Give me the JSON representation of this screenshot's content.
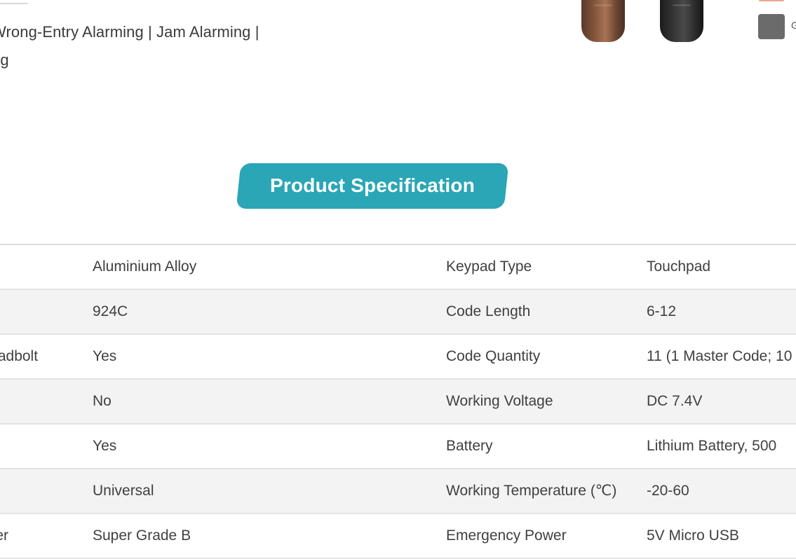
{
  "features": {
    "line1": "Wrong-Entry Alarming | Jam Alarming |",
    "line2": "ng"
  },
  "products": [
    {
      "name": "bronze-lock",
      "color": "#8a5a40"
    },
    {
      "name": "black-lock",
      "color": "#383838"
    }
  ],
  "swatch": {
    "color": "#6b6b6b",
    "label": "G"
  },
  "section": {
    "title": "Product Specification",
    "accent": "#2aa6b6"
  },
  "specs": {
    "rows": [
      {
        "label1": "",
        "value1": "Aluminium Alloy",
        "label2": "Keypad Type",
        "value2": "Touchpad"
      },
      {
        "label1": "",
        "value1": "924C",
        "label2": "Code Length",
        "value2": "6-12"
      },
      {
        "label1": "Deadbolt",
        "value1": "Yes",
        "label2": "Code Quantity",
        "value2": "11 (1 Master Code; 10"
      },
      {
        "label1": "",
        "value1": "No",
        "label2": "Working Voltage",
        "value2": "DC 7.4V"
      },
      {
        "label1": "",
        "value1": "Yes",
        "label2": "Battery",
        "value2": "Lithium Battery, 500"
      },
      {
        "label1": "",
        "value1": "Universal",
        "label2": "Working Temperature (℃)",
        "value2": "-20-60"
      },
      {
        "label1": "nder",
        "value1": "Super Grade B",
        "label2": "Emergency Power",
        "value2": "5V Micro USB"
      }
    ]
  }
}
